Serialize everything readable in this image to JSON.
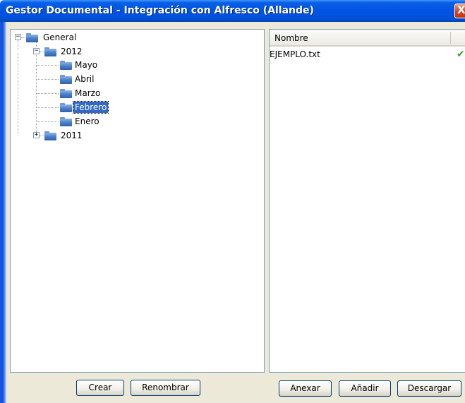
{
  "window": {
    "title": "Gestor Documental - Integración con Alfresco (Allande)",
    "close_glyph": "X"
  },
  "tree": {
    "root": {
      "label": "General",
      "expander": "−"
    },
    "years": [
      {
        "label": "2012",
        "expander": "−",
        "months": [
          "Mayo",
          "Abril",
          "Marzo",
          "Febrero",
          "Enero"
        ],
        "selected_month": "Febrero"
      },
      {
        "label": "2011",
        "expander": "+"
      }
    ]
  },
  "file_list": {
    "column_header": "Nombre",
    "files": [
      {
        "name": "EJEMPLO.txt",
        "status_icon": "check-icon",
        "status_color": "#3aa42a",
        "status_glyph": "✔"
      }
    ]
  },
  "buttons": {
    "crear": "Crear",
    "renombrar": "Renombrar",
    "anexar": "Anexar",
    "anadir": "Añadir",
    "descargar": "Descargar"
  },
  "colors": {
    "titlebar": "#0054e3",
    "selection": "#316ac5",
    "dialog_bg": "#ece9d8"
  }
}
